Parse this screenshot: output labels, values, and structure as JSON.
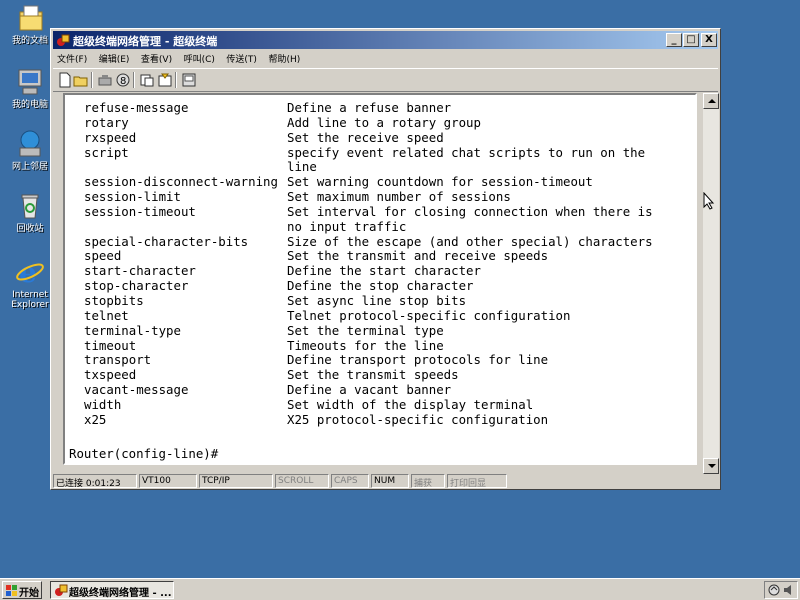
{
  "desktop": {
    "icons": [
      {
        "label": "我的文档",
        "icon": "my-documents-icon"
      },
      {
        "label": "我的电脑",
        "icon": "my-computer-icon"
      },
      {
        "label": "网上邻居",
        "icon": "network-places-icon"
      },
      {
        "label": "回收站",
        "icon": "recycle-bin-icon"
      },
      {
        "label": "Internet Explorer",
        "icon": "internet-explorer-icon"
      }
    ]
  },
  "window": {
    "title": "超级终端网络管理 - 超级终端",
    "controls": {
      "minimize": "_",
      "maximize": "□",
      "close": "X"
    },
    "menu": [
      "文件(F)",
      "编辑(E)",
      "查看(V)",
      "呼叫(C)",
      "传送(T)",
      "帮助(H)"
    ],
    "toolbar": [
      "new-icon",
      "open-icon",
      "disconnect-icon",
      "properties-icon",
      "send-icon",
      "receive-icon",
      "call-icon"
    ],
    "terminal": {
      "rows": [
        {
          "cmd": "refuse-message",
          "desc": "Define a refuse banner"
        },
        {
          "cmd": "rotary",
          "desc": "Add line to a rotary group"
        },
        {
          "cmd": "rxspeed",
          "desc": "Set the receive speed"
        },
        {
          "cmd": "script",
          "desc": "specify event related chat scripts to run on the"
        },
        {
          "cmd": "",
          "desc": "line"
        },
        {
          "cmd": "session-disconnect-warning",
          "desc": "Set warning countdown for session-timeout"
        },
        {
          "cmd": "session-limit",
          "desc": "Set maximum number of sessions"
        },
        {
          "cmd": "session-timeout",
          "desc": "Set interval for closing connection when there is"
        },
        {
          "cmd": "",
          "desc": "no input traffic"
        },
        {
          "cmd": "special-character-bits",
          "desc": "Size of the escape (and other special) characters"
        },
        {
          "cmd": "speed",
          "desc": "Set the transmit and receive speeds"
        },
        {
          "cmd": "start-character",
          "desc": "Define the start character"
        },
        {
          "cmd": "stop-character",
          "desc": "Define the stop character"
        },
        {
          "cmd": "stopbits",
          "desc": "Set async line stop bits"
        },
        {
          "cmd": "telnet",
          "desc": "Telnet protocol-specific configuration"
        },
        {
          "cmd": "terminal-type",
          "desc": "Set the terminal type"
        },
        {
          "cmd": "timeout",
          "desc": "Timeouts for the line"
        },
        {
          "cmd": "transport",
          "desc": "Define transport protocols for line"
        },
        {
          "cmd": "txspeed",
          "desc": "Set the transmit speeds"
        },
        {
          "cmd": "vacant-message",
          "desc": "Define a vacant banner"
        },
        {
          "cmd": "width",
          "desc": "Set width of the display terminal"
        },
        {
          "cmd": "x25",
          "desc": "X25 protocol-specific configuration"
        }
      ],
      "prompt": "Router(config-line)#"
    },
    "status": {
      "connected": "已连接 0:01:23",
      "emulation": "VT100",
      "protocol": "TCP/IP",
      "scroll": "SCROLL",
      "caps": "CAPS",
      "num": "NUM",
      "capture": "捕获",
      "print_echo": "打印回显"
    }
  },
  "taskbar": {
    "start_label": "开始",
    "task_label": "超级终端网络管理 - ..."
  }
}
